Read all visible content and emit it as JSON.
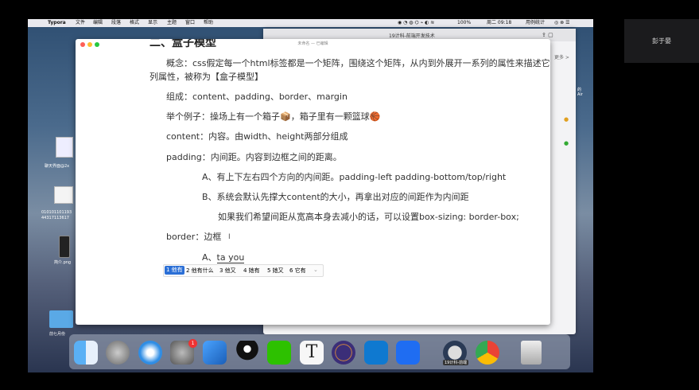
{
  "menubar": {
    "apple": "",
    "app": "Typora",
    "items": [
      "文件",
      "编辑",
      "段落",
      "格式",
      "显示",
      "主题",
      "窗口",
      "帮助"
    ],
    "battery": "100%",
    "clock": "周二 09:18",
    "user": "用例统计"
  },
  "meeting": {
    "participant": "彭于晏"
  },
  "background_window": {
    "title": "19计科-前端开发技术",
    "more": "更多 >",
    "side_text": [
      "的",
      "Air"
    ]
  },
  "typora": {
    "title": "未命名 — 已编辑",
    "heading": "二、盒子模型",
    "concept_line1": "概念：css假定每一个html标签都是一个矩阵，围绕这个矩阵，从内到外展开一系列的属性来描述它，这",
    "concept_line2": "列属性，被称为【盒子模型】",
    "compose": "组成：content、padding、border、margin",
    "example": "举个例子：操场上有一个箱子📦，箱子里有一颗篮球🏀",
    "content": "content：内容。由width、height两部分组成",
    "padding": "padding：内间距。内容到边框之间的距离。",
    "padding_a": "A、有上下左右四个方向的内间距。padding-left  padding-bottom/top/right",
    "padding_b": "B、系统会默认先撑大content的大小，再拿出对应的间距作为内间距",
    "padding_c": "如果我们希望间距从宽高本身去减小的话，可以设置box-sizing: border-box;",
    "border": "border：边框",
    "border_a_prefix": "A、",
    "border_a_typing": "ta you"
  },
  "ime": {
    "candidates": [
      "1 他有",
      "2 他有什么",
      "3 他又",
      "4 她有",
      "5 她又",
      "6 它有"
    ],
    "more": "⌄"
  },
  "desktop_icons": [
    {
      "label": "聊天界面@2x"
    },
    {
      "label": "010101101193"
    },
    {
      "label": "44317113617"
    },
    {
      "label": "简介.png"
    },
    {
      "label": "前七月份"
    }
  ],
  "dock": {
    "apps": [
      "finder",
      "launchpad",
      "safari",
      "system-preferences",
      "xcode",
      "qq",
      "wechat",
      "typora",
      "eclipse",
      "vscode",
      "lanhu",
      "qq-avatar",
      "chrome",
      "trash"
    ],
    "badge": "1",
    "tooltip": "19计科-前端"
  },
  "colors": {
    "accent": "#2b6fd6",
    "close": "#fe5f57",
    "minimize": "#febc2e",
    "maximize": "#28c840"
  }
}
